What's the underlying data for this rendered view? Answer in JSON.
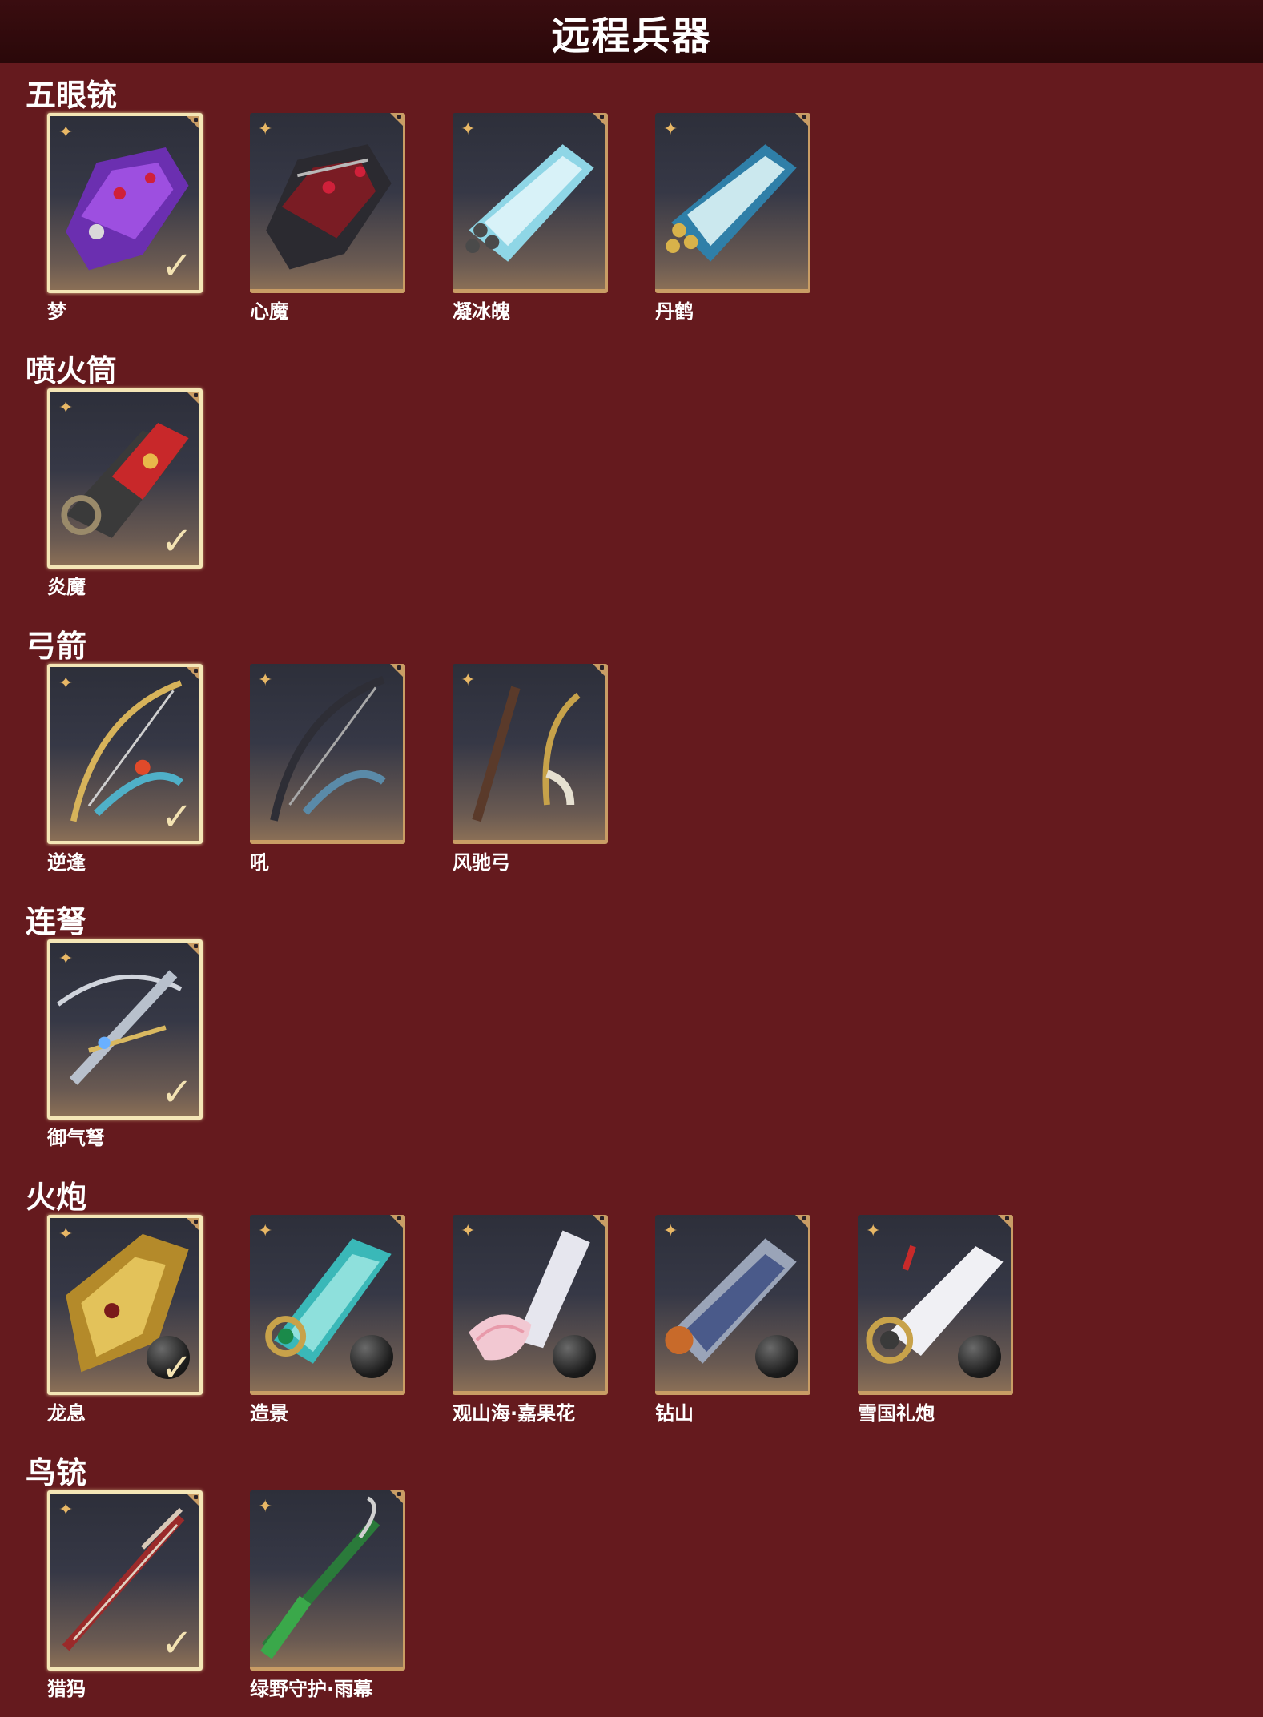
{
  "page_title": "远程兵器",
  "colors": {
    "background": "#651a1e",
    "header": "#2f0b0d",
    "card_border": "#c99d65",
    "selected_border": "#f4e6b6",
    "star": "#e8b765"
  },
  "sections": [
    {
      "title": "五眼铳",
      "items": [
        {
          "name": "梦",
          "selected": true,
          "icon": "purple-gun-icon"
        },
        {
          "name": "心魔",
          "selected": false,
          "icon": "red-dark-gun-icon"
        },
        {
          "name": "凝冰魄",
          "selected": false,
          "icon": "ice-gun-icon"
        },
        {
          "name": "丹鹤",
          "selected": false,
          "icon": "crane-gun-icon"
        }
      ]
    },
    {
      "title": "喷火筒",
      "items": [
        {
          "name": "炎魔",
          "selected": true,
          "icon": "flame-tube-icon"
        }
      ]
    },
    {
      "title": "弓箭",
      "items": [
        {
          "name": "逆逢",
          "selected": true,
          "icon": "golden-bow-icon"
        },
        {
          "name": "吼",
          "selected": false,
          "icon": "dark-bow-icon"
        },
        {
          "name": "风驰弓",
          "selected": false,
          "icon": "horse-bow-icon"
        }
      ]
    },
    {
      "title": "连弩",
      "items": [
        {
          "name": "御气弩",
          "selected": true,
          "icon": "crossbow-icon"
        }
      ]
    },
    {
      "title": "火炮",
      "items": [
        {
          "name": "龙息",
          "selected": true,
          "icon": "dragon-cannon-icon",
          "ball": true
        },
        {
          "name": "造景",
          "selected": false,
          "icon": "jade-cannon-icon",
          "ball": true
        },
        {
          "name": "观山海·嘉果花",
          "selected": false,
          "icon": "flower-cannon-icon",
          "ball": true
        },
        {
          "name": "钻山",
          "selected": false,
          "icon": "drill-cannon-icon",
          "ball": true
        },
        {
          "name": "雪国礼炮",
          "selected": false,
          "icon": "snow-cannon-icon",
          "ball": true
        }
      ]
    },
    {
      "title": "鸟铳",
      "items": [
        {
          "name": "猎犸",
          "selected": true,
          "icon": "red-musket-icon"
        },
        {
          "name": "绿野守护·雨幕",
          "selected": false,
          "icon": "green-musket-icon"
        }
      ]
    }
  ]
}
